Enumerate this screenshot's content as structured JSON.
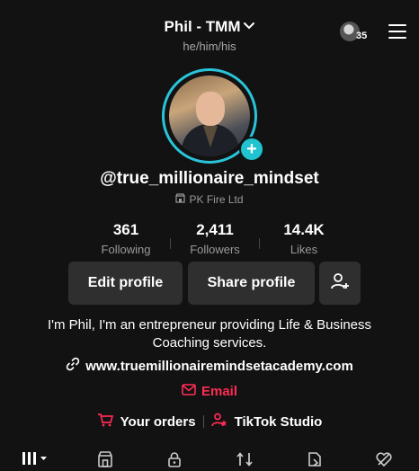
{
  "header": {
    "title": "Phil - TMM",
    "pronouns": "he/him/his",
    "notification_count": "35"
  },
  "profile": {
    "username": "@true_millionaire_mindset",
    "company": "PK Fire Ltd"
  },
  "stats": [
    {
      "value": "361",
      "label": "Following"
    },
    {
      "value": "2,411",
      "label": "Followers"
    },
    {
      "value": "14.4K",
      "label": "Likes"
    }
  ],
  "buttons": {
    "edit_profile": "Edit profile",
    "share_profile": "Share profile"
  },
  "bio": {
    "line1": "I'm Phil, I'm an entrepreneur providing Life & Business",
    "line2": "Coaching services."
  },
  "links": {
    "website": "www.truemillionairemindsetacademy.com",
    "email": "Email",
    "orders": "Your orders",
    "studio": "TikTok Studio"
  },
  "colors": {
    "background": "#121212",
    "accent_red": "#fe2c55",
    "ring": "#29c4d9"
  },
  "tab_icons": [
    "grid-icon",
    "shop-icon",
    "lock-icon",
    "repost-icon",
    "favorites-icon",
    "liked-icon"
  ]
}
